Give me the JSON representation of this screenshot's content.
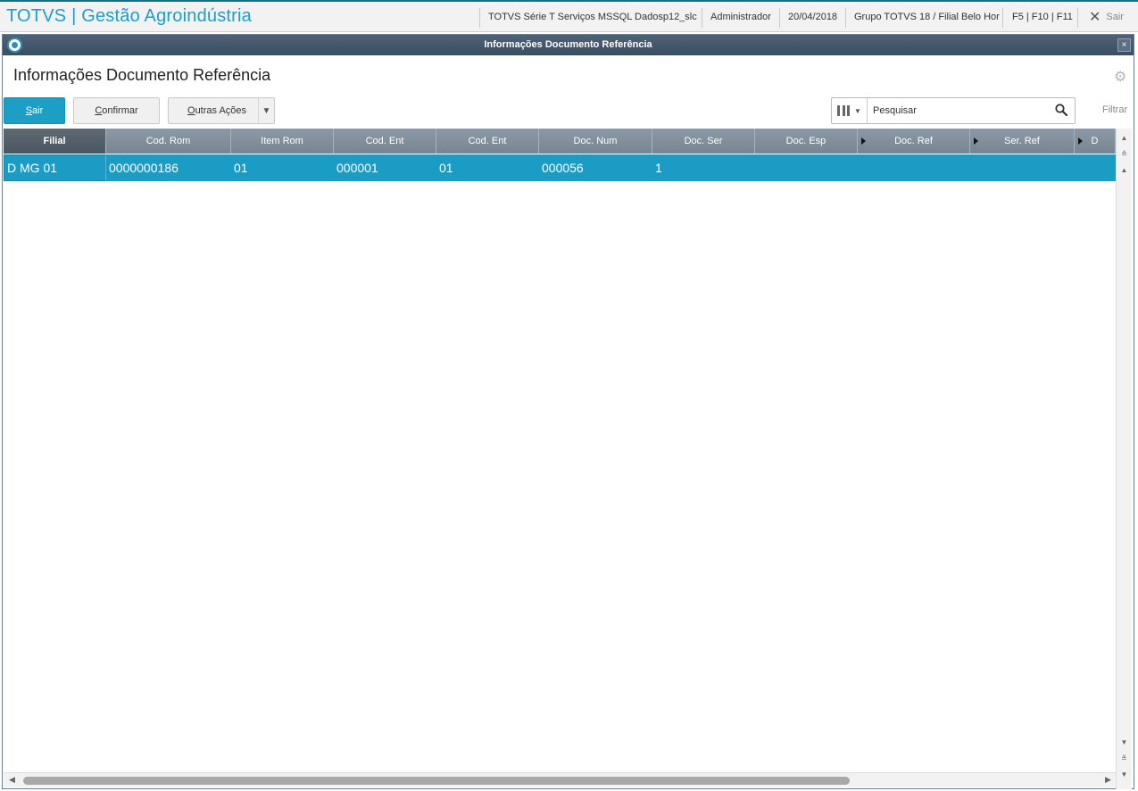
{
  "app": {
    "brand": "TOTVS | Gestão Agroindústria",
    "environment": "TOTVS Série T Serviços MSSQL Dadosp12_slc",
    "user": "Administrador",
    "date": "20/04/2018",
    "branch": "Grupo TOTVS 18 / Filial Belo Hor",
    "shortcuts": "F5 | F10 | F11",
    "exit_label": "Sair"
  },
  "window": {
    "title": "Informações Documento Referência",
    "close_glyph": "×"
  },
  "page": {
    "heading": "Informações Documento Referência"
  },
  "toolbar": {
    "sair": {
      "first": "S",
      "rest": "air"
    },
    "confirmar": {
      "first": "C",
      "rest": "onfirmar"
    },
    "outras": {
      "first": "O",
      "rest": "utras Ações"
    },
    "search_placeholder": "Pesquisar",
    "filter_label": "Filtrar"
  },
  "grid": {
    "columns": [
      "Filial",
      "Cod. Rom",
      "Item Rom",
      "Cod. Ent",
      "Cod. Ent",
      "Doc. Num",
      "Doc. Ser",
      "Doc. Esp",
      "Doc. Ref",
      "Ser. Ref",
      "D"
    ],
    "rows": [
      [
        "D MG 01",
        "0000000186",
        "01",
        "000001",
        "01",
        "000056",
        "1",
        "",
        "",
        "",
        ""
      ]
    ],
    "selected_row": 0,
    "selected_column": 0
  },
  "icons": {
    "app_logo": "totvs-logo-icon",
    "settings": "gear-icon",
    "search": "search-icon",
    "columns": "columns-icon",
    "close": "close-icon"
  },
  "colors": {
    "brand": "#1b9fc6",
    "primary_button": "#1c9ec5",
    "selected_row": "#1b9cc5",
    "title_bar": "#44576b",
    "grid_header": "#808f9a"
  }
}
